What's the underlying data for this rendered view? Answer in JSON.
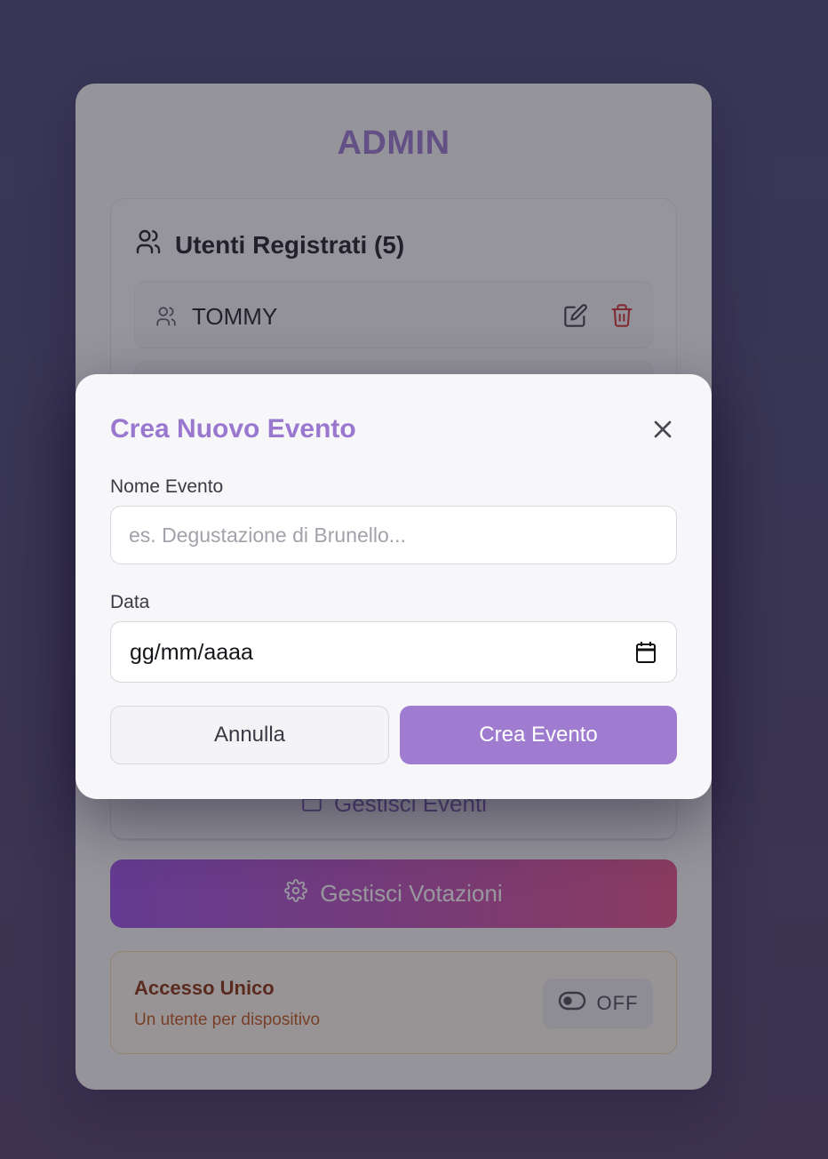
{
  "admin": {
    "title": "ADMIN",
    "users_header": "Utenti Registrati (5)",
    "users": [
      {
        "name": "TOMMY"
      }
    ],
    "manage_events_label": "Gestisci Eventi",
    "manage_votes_label": "Gestisci Votazioni",
    "access": {
      "title": "Accesso Unico",
      "subtitle": "Un utente per dispositivo",
      "toggle_label": "OFF"
    }
  },
  "modal": {
    "title": "Crea Nuovo Evento",
    "name_label": "Nome Evento",
    "name_placeholder": "es. Degustazione di Brunello...",
    "date_label": "Data",
    "date_placeholder": "gg/mm/aaaa",
    "cancel_label": "Annulla",
    "create_label": "Crea Evento"
  },
  "colors": {
    "accent": "#9a78d0",
    "primary_button": "#9f7ccf",
    "delete": "#d32f2f",
    "votes_gradient_start": "#9b4fe8",
    "votes_gradient_end": "#e6508a"
  },
  "icons": {
    "users": "users-icon",
    "user_row": "user-icon",
    "edit": "edit-icon",
    "delete": "trash-icon",
    "calendar": "calendar-icon",
    "settings": "gear-icon",
    "toggle": "toggle-icon",
    "close": "close-icon"
  }
}
